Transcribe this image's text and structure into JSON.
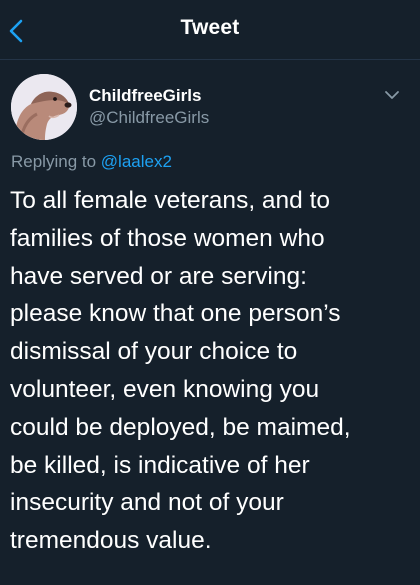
{
  "header": {
    "title": "Tweet",
    "back_icon": "chevron-left-icon"
  },
  "tweet": {
    "author": {
      "display_name": "ChildfreeGirls",
      "handle": "@ChildfreeGirls",
      "avatar_icon": "otter-avatar"
    },
    "replying_to_label": "Replying to",
    "replying_to_handle": "@laalex2",
    "menu_icon": "chevron-down-icon",
    "body_lines": [
      "To all female veterans, and to",
      "families of those women who",
      "have served or are serving:",
      "please know that one person’s",
      "dismissal of your choice to",
      "volunteer, even knowing you",
      "could be deployed, be maimed,",
      "be killed, is indicative of her",
      "insecurity and not of your",
      "tremendous value."
    ]
  },
  "colors": {
    "background": "#15202b",
    "primary_text": "#ffffff",
    "secondary_text": "#8899a6",
    "accent": "#1da1f2"
  }
}
